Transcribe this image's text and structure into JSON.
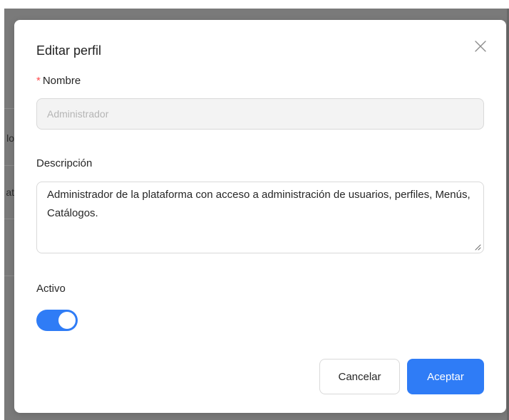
{
  "background": {
    "clipped_texts": [
      "lo",
      "at"
    ]
  },
  "modal": {
    "title": "Editar perfil",
    "close_icon": "close-icon",
    "fields": {
      "name": {
        "required_mark": "*",
        "label": "Nombre",
        "placeholder": "Administrador",
        "value": ""
      },
      "description": {
        "label": "Descripción",
        "value": "Administrador de la plataforma con acceso a administración de usuarios, perfiles, Menús, Catálogos."
      },
      "active": {
        "label": "Activo",
        "checked": true
      }
    },
    "buttons": {
      "cancel_label": "Cancelar",
      "ok_label": "Aceptar"
    }
  },
  "colors": {
    "primary": "#2f7cf6",
    "required": "#ff4d4f",
    "overlay": "#7a7a7a"
  }
}
